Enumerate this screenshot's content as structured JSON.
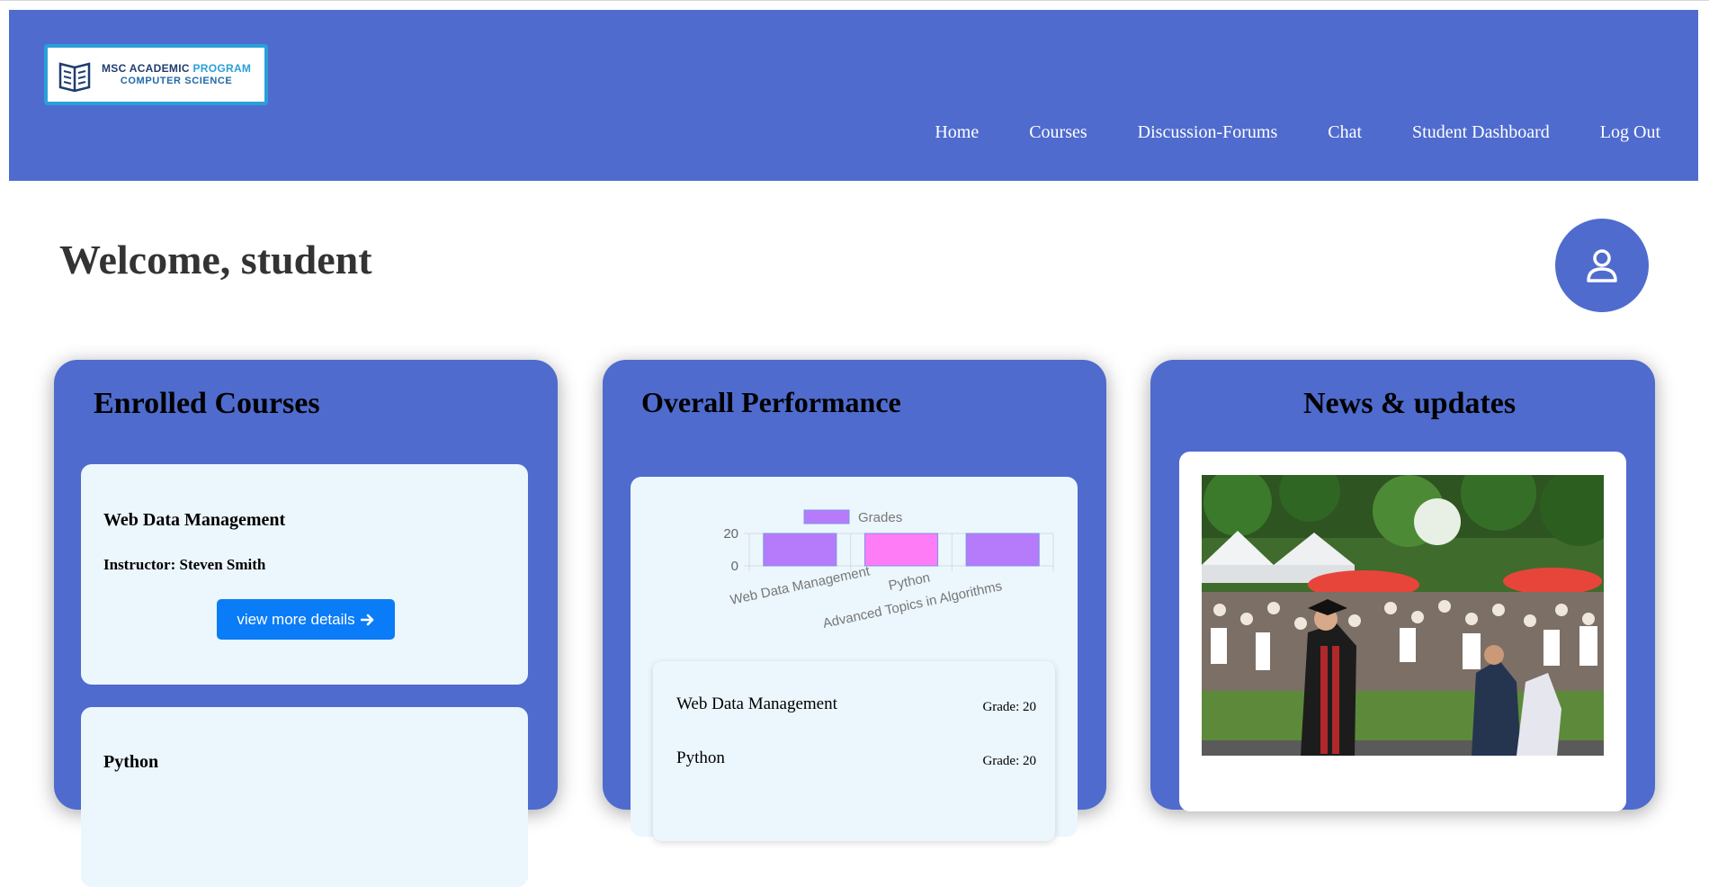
{
  "brand": {
    "line1_a": "MSC ACADEMIC ",
    "line1_b": "PROGRAM",
    "line2": "COMPUTER SCIENCE"
  },
  "nav": [
    "Home",
    "Courses",
    "Discussion-Forums",
    "Chat",
    "Student Dashboard",
    "Log Out"
  ],
  "welcome": "Welcome, student",
  "enrolled": {
    "title": "Enrolled Courses",
    "courses": [
      {
        "name": "Web Data Management",
        "instructor": "Instructor: Steven Smith",
        "button": "view more details"
      },
      {
        "name": "Python"
      }
    ]
  },
  "performance": {
    "title": "Overall Performance",
    "grades": [
      {
        "course": "Web Data Management",
        "grade": "Grade: 20"
      },
      {
        "course": "Python",
        "grade": "Grade: 20"
      }
    ]
  },
  "news": {
    "title": "News & updates"
  },
  "colors": {
    "primary": "#4f6bce",
    "card": "#ecf6fd",
    "button": "#0a7cf7",
    "bar_purple": "#b57bfa",
    "bar_pink": "#ff7cf7"
  },
  "chart_data": {
    "type": "bar",
    "categories": [
      "Web Data Management",
      "Python",
      "Advanced Topics in Algorithms"
    ],
    "series": [
      {
        "name": "Grades",
        "values": [
          20,
          20,
          20
        ]
      }
    ],
    "yticks": [
      0,
      20
    ],
    "ylim": [
      0,
      20
    ],
    "legend": "top",
    "grid": true
  }
}
